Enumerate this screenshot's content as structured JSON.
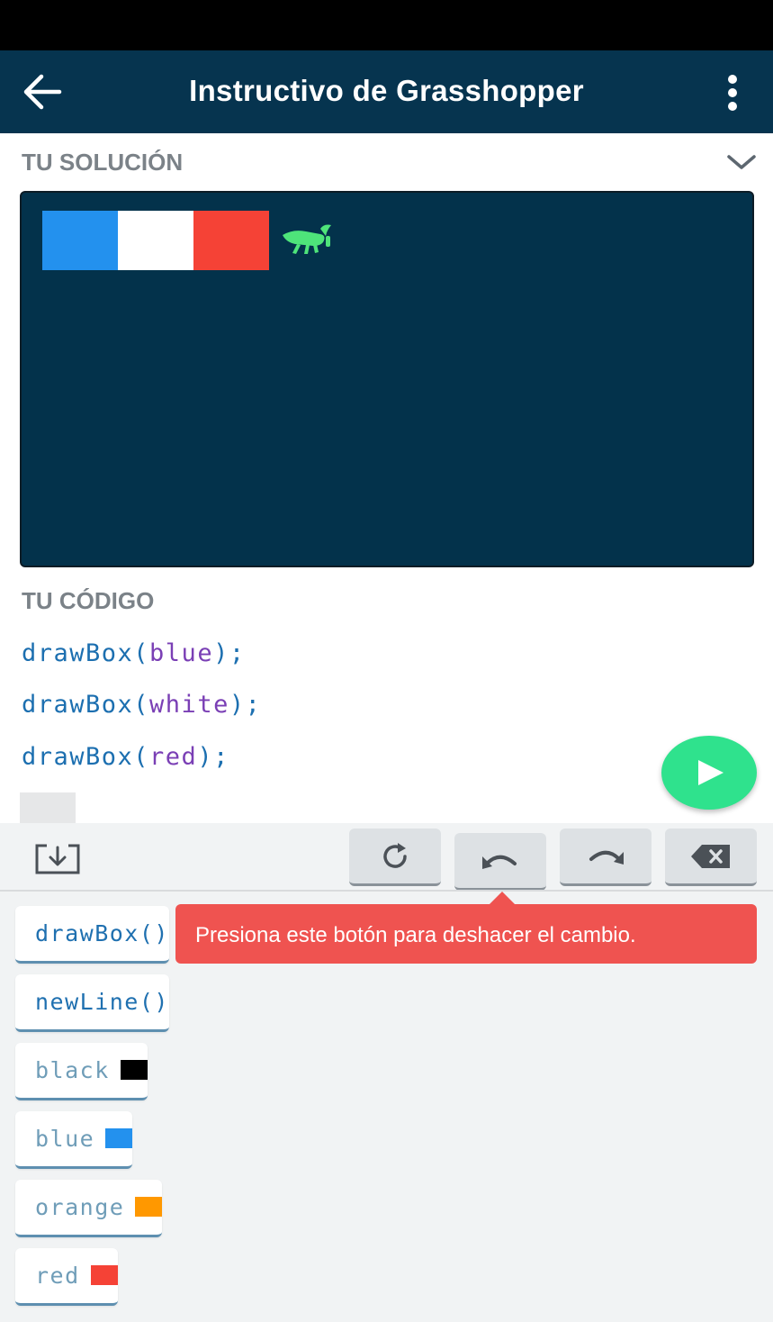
{
  "app_bar": {
    "title": "Instructivo de Grasshopper",
    "back_icon": "arrow-left-icon",
    "more_icon": "more-vertical-icon",
    "background": "#06344f"
  },
  "solution": {
    "heading": "TU SOLUCIÓN",
    "collapse_icon": "chevron-down-icon",
    "canvas_background": "#03324b",
    "drawn_boxes": [
      {
        "color_name": "blue",
        "color": "#2391ee"
      },
      {
        "color_name": "white",
        "color": "#ffffff"
      },
      {
        "color_name": "red",
        "color": "#f54236"
      }
    ],
    "grasshopper_icon": "grasshopper-icon",
    "grasshopper_color": "#4ee47a"
  },
  "code": {
    "heading": "TU CÓDIGO",
    "lines": [
      {
        "fn": "drawBox(",
        "arg": "blue",
        "end": ");"
      },
      {
        "fn": "drawBox(",
        "arg": "white",
        "end": ");"
      },
      {
        "fn": "drawBox(",
        "arg": "red",
        "end": ");"
      }
    ],
    "run_icon": "play-icon",
    "run_color": "#2fe28d"
  },
  "toolbar": {
    "download_icon": "download-icon",
    "keys": [
      {
        "icon": "refresh-icon"
      },
      {
        "icon": "undo-icon"
      },
      {
        "icon": "redo-icon"
      },
      {
        "icon": "backspace-icon"
      }
    ]
  },
  "tooltip": {
    "text": "Presiona este botón para deshacer el cambio.",
    "color": "#ef5350"
  },
  "keyboard": {
    "chips": [
      {
        "label": "drawBox()",
        "kind": "function"
      },
      {
        "label": "newLine()",
        "kind": "function"
      },
      {
        "label": "black",
        "kind": "color",
        "swatch": "#000000"
      },
      {
        "label": "blue",
        "kind": "color",
        "swatch": "#2391ee"
      },
      {
        "label": "orange",
        "kind": "color",
        "swatch": "#ff9800"
      },
      {
        "label": "red",
        "kind": "color",
        "swatch": "#f54236"
      }
    ]
  }
}
